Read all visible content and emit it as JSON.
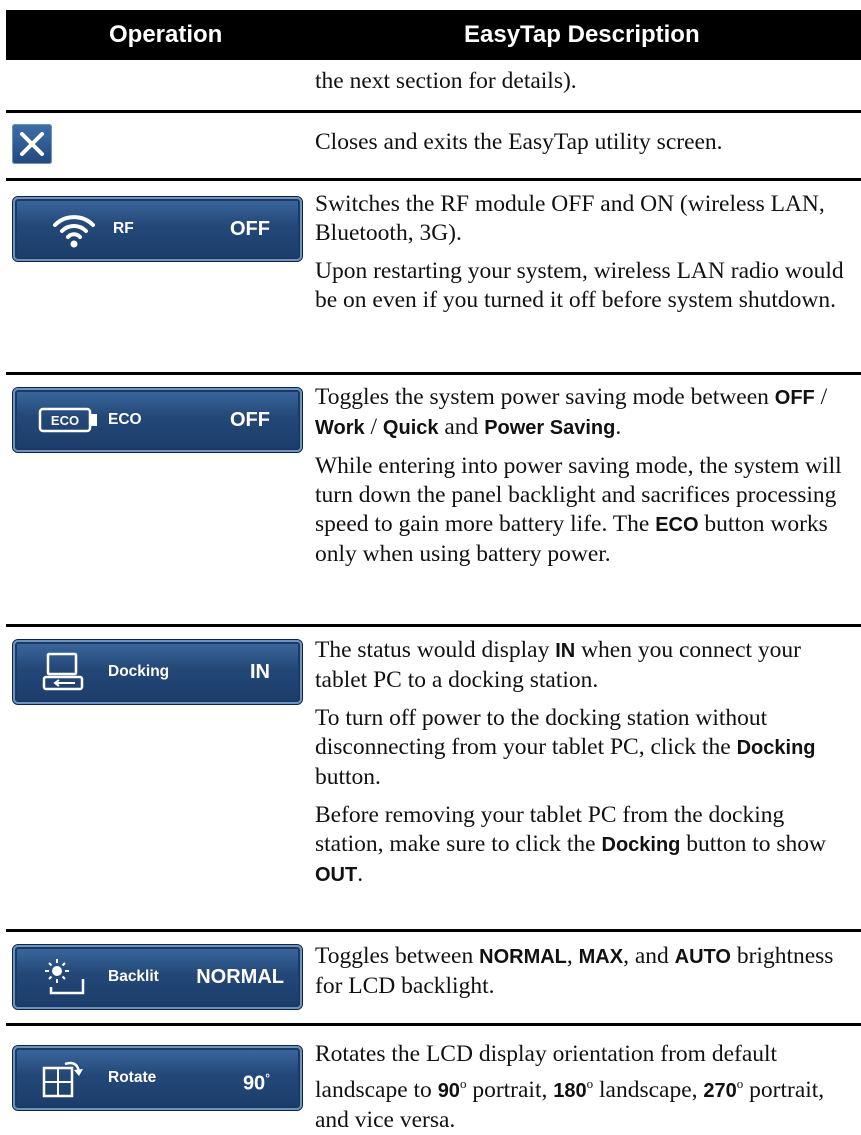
{
  "header": {
    "operation": "Operation",
    "description": "EasyTap Description"
  },
  "rows": {
    "cont": {
      "text": "the next section for details)."
    },
    "close": {
      "icon": "close-icon",
      "text": "Closes and exits the EasyTap utility screen."
    },
    "rf": {
      "icon": "wifi-icon",
      "label": "RF",
      "status": "OFF",
      "p1": "Switches the RF module OFF and ON (wireless LAN, Bluetooth, 3G).",
      "p2": "Upon restarting your system, wireless LAN radio would be on even if you turned it off before system shutdown."
    },
    "eco": {
      "icon": "battery-icon",
      "icon_text": "ECO",
      "label": "ECO",
      "status": "OFF",
      "p1_a": "Toggles the system power saving mode between ",
      "p1_b1": "OFF",
      "p1_s1": " / ",
      "p1_b2": "Work",
      "p1_s2": " / ",
      "p1_b3": "Quick",
      "p1_s3": " and ",
      "p1_b4": "Power Saving",
      "p1_end": ".",
      "p2_a": "While entering into power saving mode, the system will turn down the panel backlight and sacrifices processing speed to gain more battery life. The ",
      "p2_b": "ECO",
      "p2_c": " button works only when using battery power."
    },
    "docking": {
      "icon": "computer-dock-icon",
      "label": "Docking",
      "status": "IN",
      "p1_a": "The status would display ",
      "p1_b": "IN",
      "p1_c": " when you connect your tablet PC to a docking station.",
      "p2_a": "To turn off power to the docking station without disconnecting from your tablet PC, click the ",
      "p2_b": "Docking",
      "p2_c": " button.",
      "p3_a": "Before removing your tablet PC from the docking station, make sure to click the ",
      "p3_b": "Docking",
      "p3_c": " button to show ",
      "p3_d": "OUT",
      "p3_e": "."
    },
    "backlit": {
      "icon": "sun-monitor-icon",
      "label": "Backlit",
      "status": "NORMAL",
      "p1_a": "Toggles between ",
      "p1_b1": "NORMAL",
      "p1_s1": ", ",
      "p1_b2": "MAX",
      "p1_s2": ", and ",
      "p1_b3": "AUTO",
      "p1_c": " brightness for LCD backlight."
    },
    "rotate": {
      "icon": "rotate-icon",
      "label": "Rotate",
      "status": "90",
      "status_sup": "°",
      "p1_a": "Rotates the LCD display orientation from default landscape to ",
      "p1_b1": "90",
      "sup": "o",
      "p1_s1": " portrait, ",
      "p1_b2": "180",
      "p1_s2": " landscape, ",
      "p1_b3": "270",
      "p1_s3": " portrait, and vice versa."
    }
  }
}
